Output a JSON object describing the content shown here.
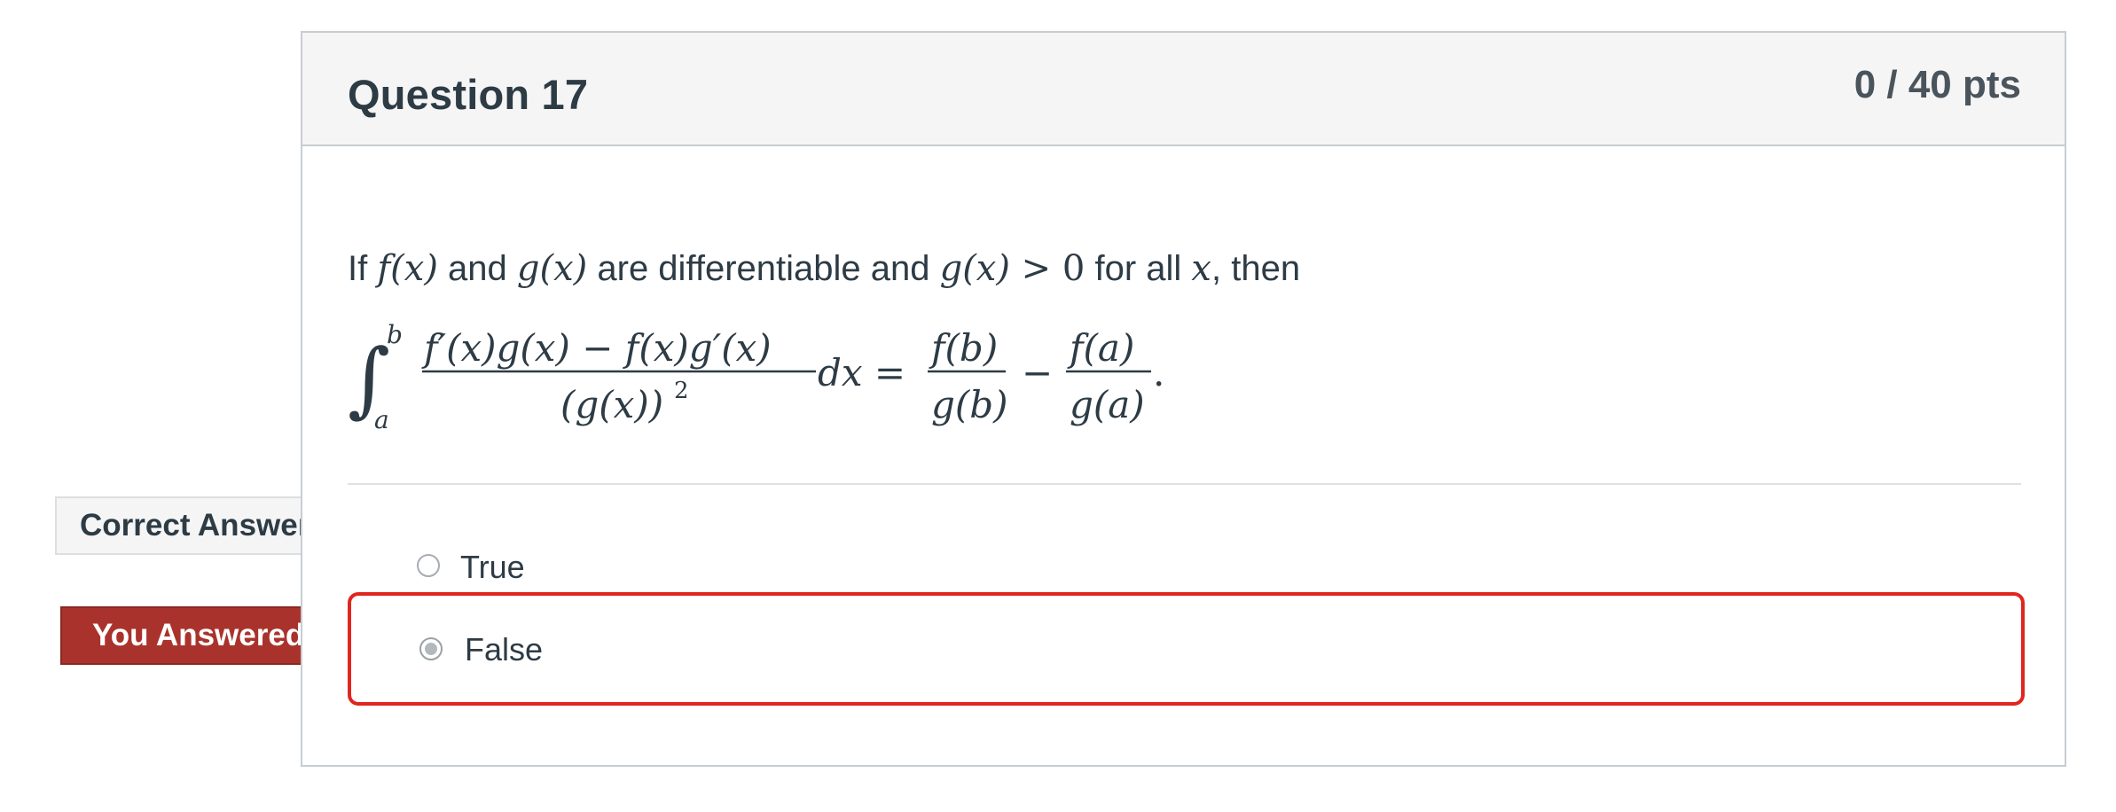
{
  "question": {
    "title": "Question 17",
    "points": "0 / 40 pts",
    "prompt": {
      "if": "If ",
      "fx": "f(x)",
      "and": " and ",
      "gx": "g(x)",
      "are_diff": " are differentiable and ",
      "gx2": "g(x)",
      "gt0": " > 0",
      "for_all": " for all ",
      "x": "x",
      "then": ", then"
    },
    "formula": {
      "integral_sign": "∫",
      "upper_limit": "b",
      "lower_limit": "a",
      "numerator": "f′(x)g(x) − f(x)g′(x)",
      "denominator": "(g(x))",
      "denominator_exp": "2",
      "dx_eq": "dx =",
      "frac1_num": "f(b)",
      "frac1_den": "g(b)",
      "minus": "−",
      "frac2_num": "f(a)",
      "frac2_den": "g(a)",
      "period": "."
    }
  },
  "answers": [
    {
      "label": "True",
      "selected": false
    },
    {
      "label": "False",
      "selected": true
    }
  ],
  "flags": {
    "correct": "Correct Answer",
    "you_answered": "You Answered"
  },
  "colors": {
    "wrong_border": "#e0261e",
    "you_answered_flag": "#a9332c",
    "header_bg": "#f5f5f5"
  }
}
